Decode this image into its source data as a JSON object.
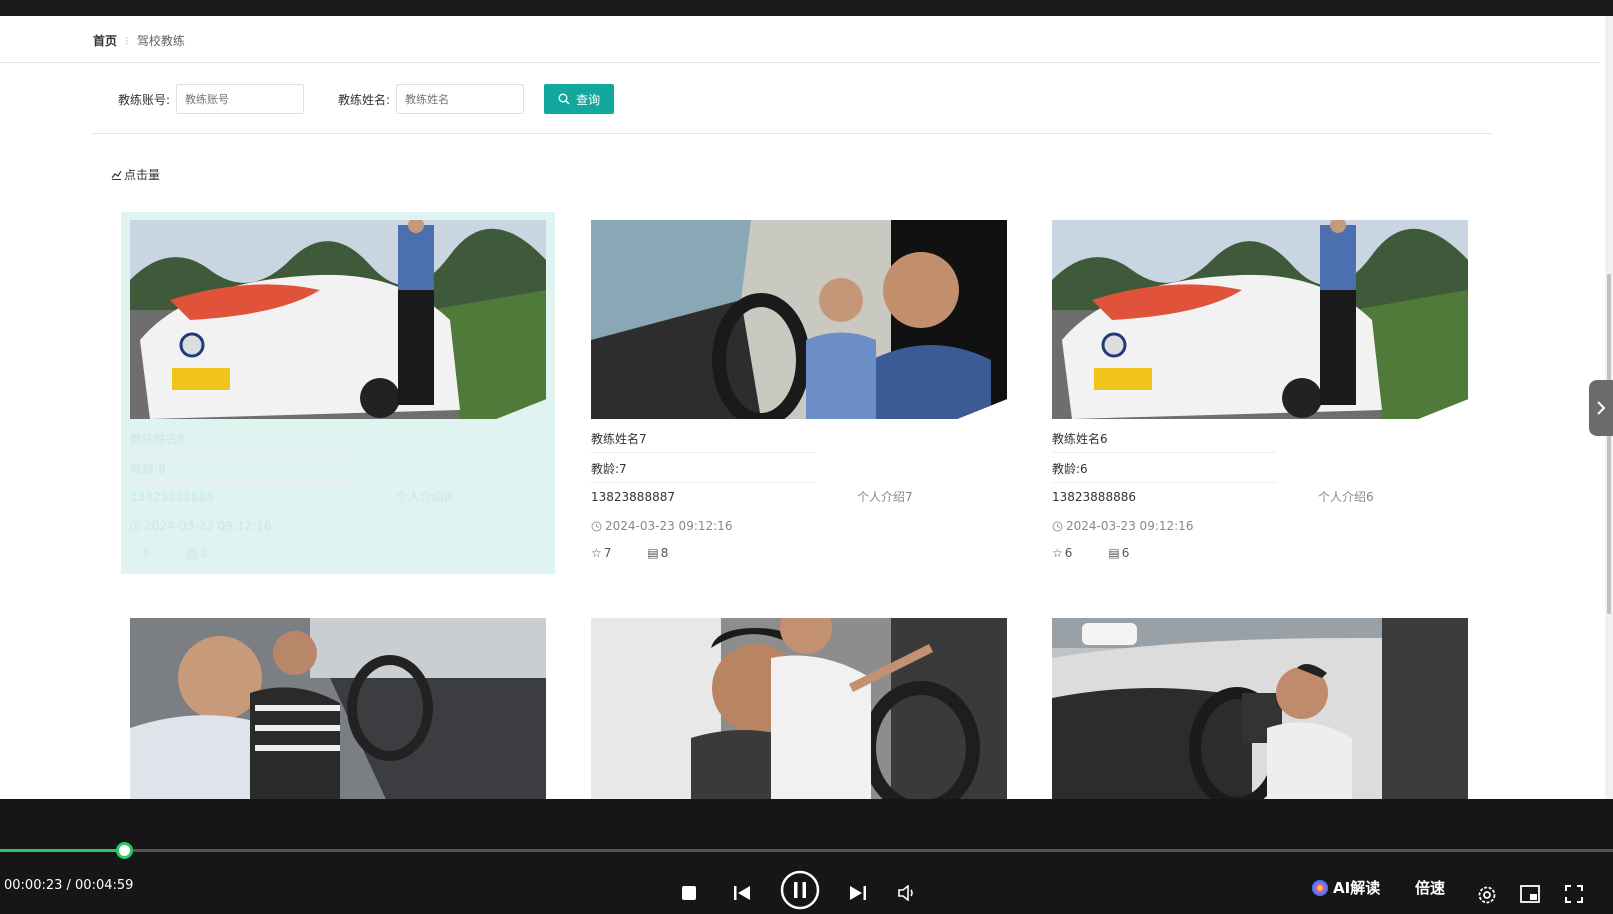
{
  "breadcrumb": {
    "home": "首页",
    "separator": "⁝",
    "current": "驾校教练"
  },
  "search": {
    "account_label": "教练账号:",
    "account_placeholder": "教练账号",
    "name_label": "教练姓名:",
    "name_placeholder": "教练姓名",
    "button_label": "查询"
  },
  "sort": {
    "label": "点击量",
    "icon": "bar-chart-icon"
  },
  "cards": [
    {
      "name": "教练姓名8",
      "age": "教龄:8",
      "phone": "13823888888",
      "intro": "个人介绍8",
      "time": "2024-03-23 09:12:16",
      "likes": "8",
      "comments": "8",
      "image": "car-white-instructor"
    },
    {
      "name": "教练姓名7",
      "age": "教龄:7",
      "phone": "13823888887",
      "intro": "个人介绍7",
      "time": "2024-03-23 09:12:16",
      "likes": "7",
      "comments": "8",
      "image": "in-car-lesson"
    },
    {
      "name": "教练姓名6",
      "age": "教龄:6",
      "phone": "13823888886",
      "intro": "个人介绍6",
      "time": "2024-03-23 09:12:16",
      "likes": "6",
      "comments": "6",
      "image": "car-white-instructor"
    }
  ],
  "row2_images": [
    "in-car-older-student",
    "in-car-pointing",
    "in-car-driver-seat"
  ],
  "player": {
    "current_time": "00:00:23",
    "duration": "00:04:59",
    "time_text": "00:00:23 / 00:04:59",
    "progress": 0.077,
    "ai_label": "AI解读",
    "speed_label": "倍速",
    "accent_color": "#2fc768"
  },
  "colors": {
    "primary": "#13a89e",
    "hover_card": "#dff3f1"
  }
}
